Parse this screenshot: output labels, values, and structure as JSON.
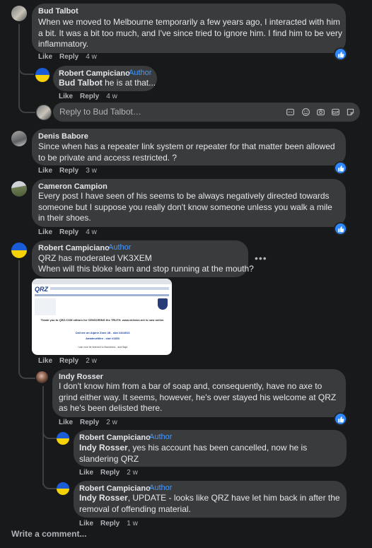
{
  "comments": [
    {
      "author": "Bud Talbot",
      "text": "When we moved to Melbourne temporarily a few years ago, I interacted with him a bit. It was a bit too much, and I've since tried to ignore him. I find him to be very inflammatory.",
      "like": "Like",
      "reply": "Reply",
      "time": "4 w",
      "replies": [
        {
          "author": "Robert Campiciano",
          "badge": "Author",
          "mention": "Bud Talbot",
          "text": " he is at that...",
          "like": "Like",
          "reply": "Reply",
          "time": "4 w"
        }
      ],
      "reply_box": {
        "placeholder": "Reply to Bud Talbot…"
      }
    },
    {
      "author": "Denis Babore",
      "text": "Since when has a repeater link system or repeater for that matter been allowed to be private and access restricted. ?",
      "like": "Like",
      "reply": "Reply",
      "time": "3 w"
    },
    {
      "author": "Cameron Campion",
      "text": "Every post I have seen of his seems to be always negatively directed towards someone but I suppose you really don't know someone unless you walk a mile in their shoes.",
      "like": "Like",
      "reply": "Reply",
      "time": "4 w"
    },
    {
      "author": "Robert Campiciano",
      "badge": "Author",
      "line1": "QRZ has moderated VK3XEM",
      "line2": "When will this bloke learn and stop running at the mouth?",
      "like": "Like",
      "reply": "Reply",
      "time": "2 w",
      "attachment": {
        "logo": "QRZ",
        "notice": "Thank you to QRZ.COM editors for CENSORING the TRUTH. www.vk3xem.net is now online.",
        "call": "Call me on Alpine Zone 28 - slot #344013",
        "line": "AmateurWire - slot #1453",
        "footer": "I can now be listened to Barcelona - and Baja"
      },
      "replies": [
        {
          "author": "Indy Rosser",
          "text": "I don't know him from a bar of soap and, consequently, have no axe to grind either way. It seems, however, he's over stayed his welcome at QRZ as he's been delisted there.",
          "like": "Like",
          "reply": "Reply",
          "time": "2 w"
        },
        {
          "author": "Robert Campiciano",
          "badge": "Author",
          "mention": "Indy Rosser",
          "text": ", yes his account has been cancelled, now he is slandering QRZ",
          "like": "Like",
          "reply": "Reply",
          "time": "2 w"
        },
        {
          "author": "Robert Campiciano",
          "badge": "Author",
          "mention": "Indy Rosser",
          "text": ", UPDATE - looks like QRZ have let him back in after the removal of offending material.",
          "like": "Like",
          "reply": "Reply",
          "time": "1 w"
        }
      ]
    }
  ],
  "write_comment": "Write a comment...",
  "colors": {
    "background": "#18191a",
    "bubble": "#3a3b3c",
    "accent": "#2d88ff",
    "author_badge": "#4599ff"
  }
}
